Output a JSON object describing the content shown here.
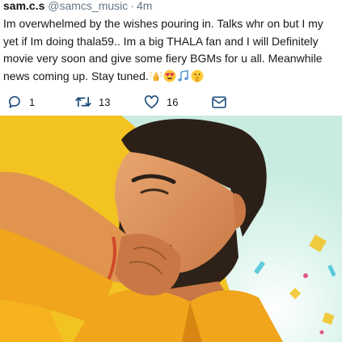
{
  "tweet": {
    "display_name": "sam.c.s",
    "handle": "@samcs_music",
    "separator": "·",
    "timestamp": "4m",
    "lines": [
      "Im overwhelmed by the wishes pouring in. Talks whr on but I my",
      "yet if Im doing thala59.. Im a big THALA fan and I will Definitely",
      "movie very soon and give some fiery BGMs for u all. Meanwhile",
      "news coming up. Stay tuned."
    ],
    "emojis": [
      "folded-hands-icon",
      "heart-eyes-icon",
      "musical-notes-icon",
      "shushing-face-icon"
    ],
    "actions": {
      "reply_count": "1",
      "retweet_count": "13",
      "like_count": "16"
    }
  },
  "colors": {
    "icon_blue": "#1b4a7a",
    "text": "#14171a",
    "muted": "#657786",
    "photo_bg_yellow": "#f2c321",
    "shirt_orange": "#f0a51c"
  }
}
